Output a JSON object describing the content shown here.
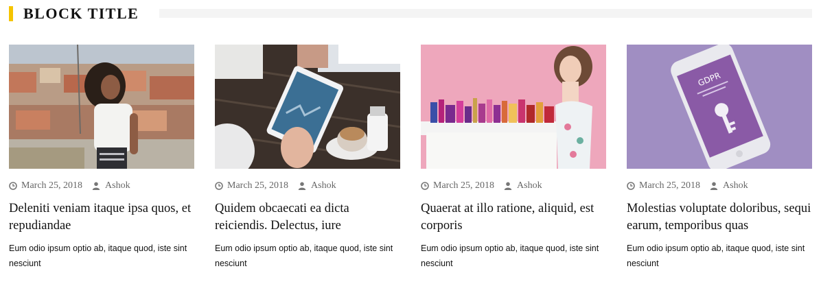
{
  "block": {
    "title": "BLOCK TITLE",
    "accent_color": "#f5c400"
  },
  "posts": [
    {
      "image": "woman-curly-hair-city-photo",
      "date": "March 25, 2018",
      "author": "Ashok",
      "title": "Deleniti veniam itaque ipsa quos, et repudiandae",
      "excerpt": "Eum odio ipsum optio ab, itaque quod, iste sint nesciunt"
    },
    {
      "image": "tablet-coffee-table-photo",
      "date": "March 25, 2018",
      "author": "Ashok",
      "title": "Quidem obcaecati ea dicta reiciendis. Delectus, iure",
      "excerpt": "Eum odio ipsum optio ab, itaque quod, iste sint nesciunt"
    },
    {
      "image": "woman-cosmetics-pink-background-photo",
      "date": "March 25, 2018",
      "author": "Ashok",
      "title": "Quaerat at illo ratione, aliquid, est corporis",
      "excerpt": "Eum odio ipsum optio ab, itaque quod, iste sint nesciunt"
    },
    {
      "image": "phone-gdpr-key-photo",
      "date": "March 25, 2018",
      "author": "Ashok",
      "title": "Molestias voluptate doloribus, sequi earum, temporibus quas",
      "excerpt": "Eum odio ipsum optio ab, itaque quod, iste sint nesciunt",
      "phone_screen_text": "GDPR"
    }
  ],
  "meta_icons": {
    "date": "clock-icon",
    "author": "user-icon"
  }
}
